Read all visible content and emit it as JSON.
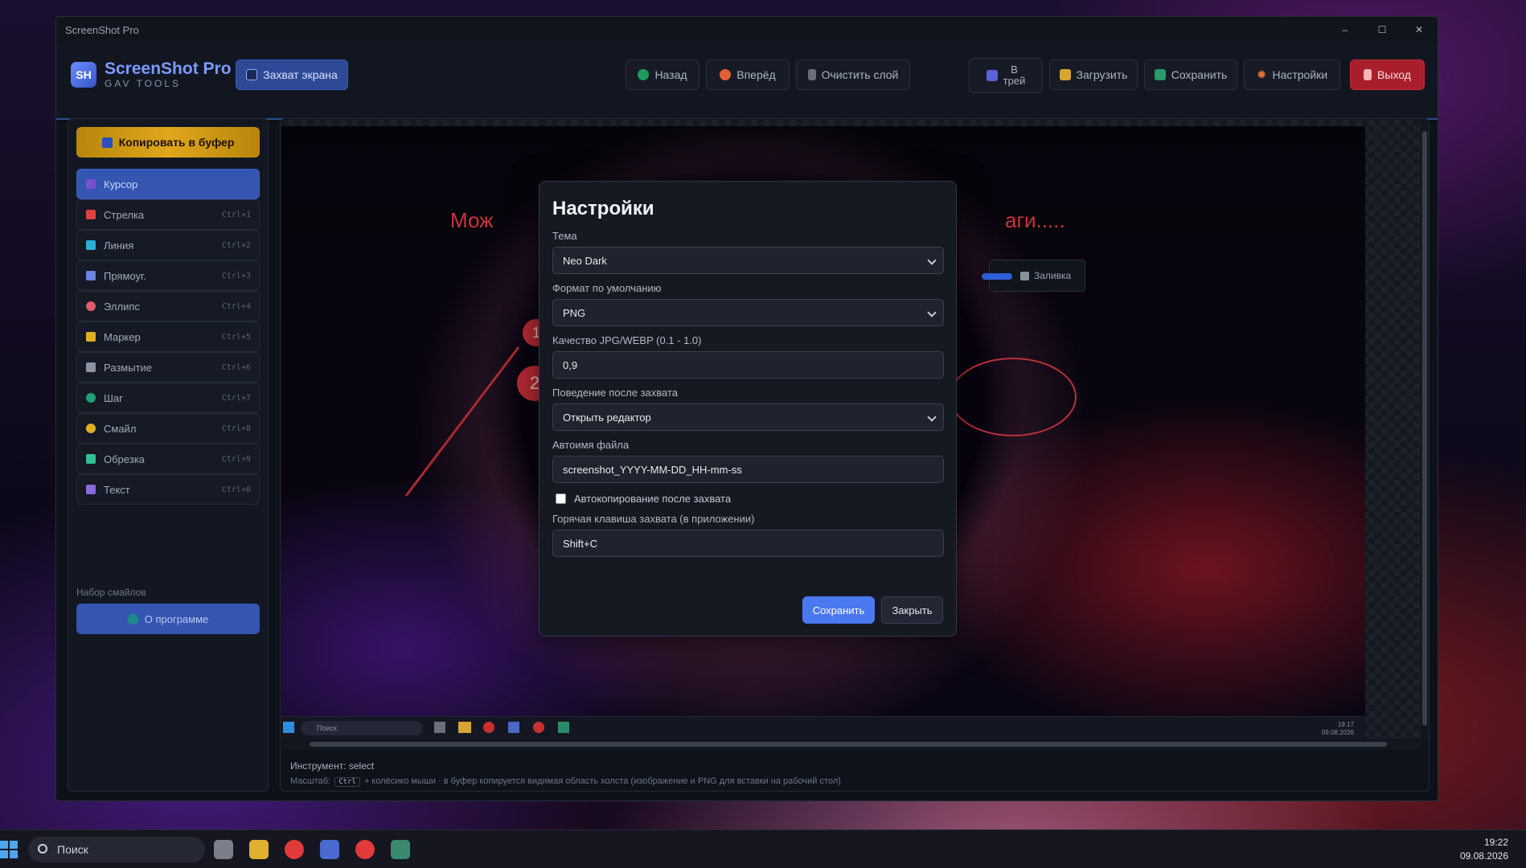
{
  "app": {
    "window_title": "ScreenShot Pro",
    "win_min": "–",
    "win_max": "☐",
    "win_close": "✕"
  },
  "logo": {
    "badge": "SH",
    "name": "ScreenShot Pro",
    "sub": "GAV TOOLS"
  },
  "toolbar": {
    "capture": "Захват экрана",
    "back": "Назад",
    "forward": "Вперёд",
    "clear_layer": "Очистить слой",
    "tray_line1": "В",
    "tray_line2": "трей",
    "load": "Загрузить",
    "save": "Сохранить",
    "settings": "Настройки",
    "exit": "Выход"
  },
  "sidebar": {
    "copy": "Копировать в буфер",
    "tools": [
      {
        "label": "Курсор",
        "shortcut": "",
        "icon": "cursor-icon",
        "color": "#7a4fd0"
      },
      {
        "label": "Стрелка",
        "shortcut": "Ctrl+1",
        "icon": "arrow-icon",
        "color": "#e0403a"
      },
      {
        "label": "Линия",
        "shortcut": "Ctrl+2",
        "icon": "line-icon",
        "color": "#2ab0d8"
      },
      {
        "label": "Прямоуг.",
        "shortcut": "Ctrl+3",
        "icon": "rectangle-icon",
        "color": "#6a86e0"
      },
      {
        "label": "Эллипс",
        "shortcut": "Ctrl+4",
        "icon": "ellipse-icon",
        "color": "#e05a6a"
      },
      {
        "label": "Маркер",
        "shortcut": "Ctrl+5",
        "icon": "marker-icon",
        "color": "#e0b020"
      },
      {
        "label": "Размытие",
        "shortcut": "Ctrl+6",
        "icon": "blur-icon",
        "color": "#8a92a3"
      },
      {
        "label": "Шаг",
        "shortcut": "Ctrl+7",
        "icon": "step-icon",
        "color": "#20a070"
      },
      {
        "label": "Смайл",
        "shortcut": "Ctrl+8",
        "icon": "smile-icon",
        "color": "#e0b020"
      },
      {
        "label": "Обрезка",
        "shortcut": "Ctrl+9",
        "icon": "crop-icon",
        "color": "#30c090"
      },
      {
        "label": "Текст",
        "shortcut": "Ctrl+0",
        "icon": "text-icon",
        "color": "#8a6ae0"
      }
    ],
    "smiles_label": "Набор смайлов",
    "about": "О программе"
  },
  "canvas": {
    "annotation_left": "Мож",
    "annotation_right": "аги.....",
    "fill_label": "Заливка",
    "step1": "1",
    "step2": "2",
    "inner_search": "Поиск",
    "inner_time": "19:17",
    "inner_date": "09.08.2026"
  },
  "statusbar": {
    "tool": "Инструмент: select",
    "hint_prefix": "Масштаб:",
    "hint_key": "Ctrl",
    "hint_suffix": "+ колёсико мыши · в буфер копируется видимая область холста (изображение и PNG для вставки на рабочий стол)"
  },
  "modal": {
    "title": "Настройки",
    "theme_label": "Тема",
    "theme_value": "Neo Dark",
    "format_label": "Формат по умолчанию",
    "format_value": "PNG",
    "quality_label": "Качество JPG/WEBP (0.1 - 1.0)",
    "quality_value": "0,9",
    "behavior_label": "Поведение после захвата",
    "behavior_value": "Открыть редактор",
    "filename_label": "Автоимя файла",
    "filename_value": "screenshot_YYYY-MM-DD_HH-mm-ss",
    "autocopy_label": "Автокопирование после захвата",
    "hotkey_label": "Горячая клавиша захвата (в приложении)",
    "hotkey_value": "Shift+C",
    "save": "Сохранить",
    "close": "Закрыть"
  },
  "taskbar": {
    "search": "Поиск",
    "time": "19:22",
    "date": "09.08.2026"
  }
}
